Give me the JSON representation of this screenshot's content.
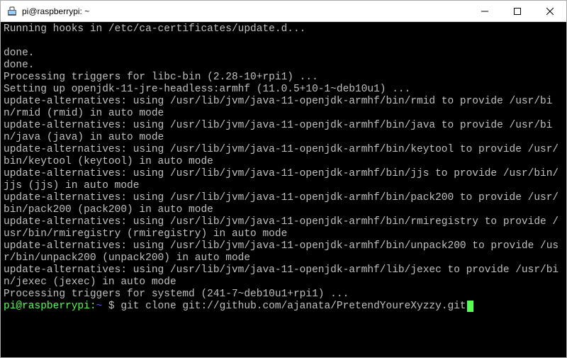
{
  "window": {
    "title": "pi@raspberrypi: ~"
  },
  "terminal": {
    "lines": [
      "Running hooks in /etc/ca-certificates/update.d...",
      "",
      "done.",
      "done.",
      "Processing triggers for libc-bin (2.28-10+rpi1) ...",
      "Setting up openjdk-11-jre-headless:armhf (11.0.5+10-1~deb10u1) ...",
      "update-alternatives: using /usr/lib/jvm/java-11-openjdk-armhf/bin/rmid to provide /usr/bin/rmid (rmid) in auto mode",
      "update-alternatives: using /usr/lib/jvm/java-11-openjdk-armhf/bin/java to provide /usr/bin/java (java) in auto mode",
      "update-alternatives: using /usr/lib/jvm/java-11-openjdk-armhf/bin/keytool to provide /usr/bin/keytool (keytool) in auto mode",
      "update-alternatives: using /usr/lib/jvm/java-11-openjdk-armhf/bin/jjs to provide /usr/bin/jjs (jjs) in auto mode",
      "update-alternatives: using /usr/lib/jvm/java-11-openjdk-armhf/bin/pack200 to provide /usr/bin/pack200 (pack200) in auto mode",
      "update-alternatives: using /usr/lib/jvm/java-11-openjdk-armhf/bin/rmiregistry to provide /usr/bin/rmiregistry (rmiregistry) in auto mode",
      "update-alternatives: using /usr/lib/jvm/java-11-openjdk-armhf/bin/unpack200 to provide /usr/bin/unpack200 (unpack200) in auto mode",
      "update-alternatives: using /usr/lib/jvm/java-11-openjdk-armhf/lib/jexec to provide /usr/bin/jexec (jexec) in auto mode",
      "Processing triggers for systemd (241-7~deb10u1+rpi1) ..."
    ],
    "prompt": {
      "user": "pi",
      "at": "@",
      "host": "raspberrypi",
      "colon": ":",
      "path": "~",
      "sigil": " $ ",
      "command": "git clone git://github.com/ajanata/PretendYoureXyzzy.git"
    }
  }
}
